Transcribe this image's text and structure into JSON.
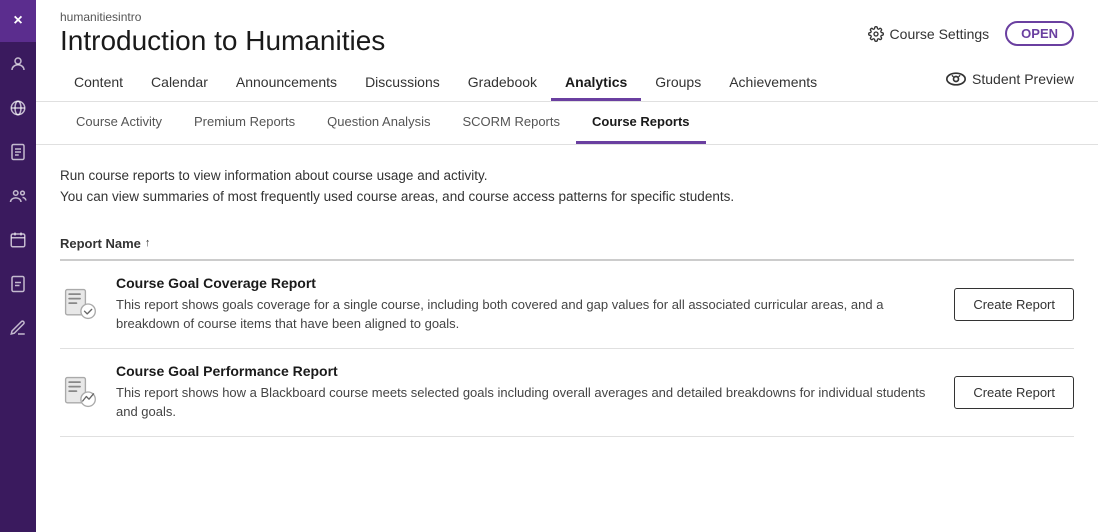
{
  "sidebar": {
    "close_label": "×",
    "icons": [
      "user",
      "globe",
      "file",
      "users",
      "calendar",
      "document",
      "edit"
    ]
  },
  "header": {
    "course_id": "humanitiesintro",
    "course_title": "Introduction to Humanities",
    "course_settings_label": "Course Settings",
    "open_label": "OPEN",
    "student_preview_label": "Student Preview"
  },
  "nav_tabs": {
    "items": [
      {
        "label": "Content",
        "active": false
      },
      {
        "label": "Calendar",
        "active": false
      },
      {
        "label": "Announcements",
        "active": false
      },
      {
        "label": "Discussions",
        "active": false
      },
      {
        "label": "Gradebook",
        "active": false
      },
      {
        "label": "Analytics",
        "active": true
      },
      {
        "label": "Groups",
        "active": false
      },
      {
        "label": "Achievements",
        "active": false
      }
    ]
  },
  "sub_tabs": {
    "items": [
      {
        "label": "Course Activity",
        "active": false
      },
      {
        "label": "Premium Reports",
        "active": false
      },
      {
        "label": "Question Analysis",
        "active": false
      },
      {
        "label": "SCORM Reports",
        "active": false
      },
      {
        "label": "Course Reports",
        "active": true
      }
    ]
  },
  "content": {
    "description_line1": "Run course reports to view information about course usage and activity.",
    "description_line2": "You can view summaries of most frequently used course areas, and course access patterns for specific students.",
    "table_header": "Report Name",
    "sort_arrow": "↑",
    "reports": [
      {
        "name": "Course Goal Coverage Report",
        "description": "This report shows goals coverage for a single course, including both covered and gap values for all associated curricular areas, and a breakdown of course items that have been aligned to goals.",
        "button_label": "Create Report"
      },
      {
        "name": "Course Goal Performance Report",
        "description": "This report shows how a Blackboard course meets selected goals including overall averages and detailed breakdowns for individual students and goals.",
        "button_label": "Create Report"
      }
    ]
  }
}
